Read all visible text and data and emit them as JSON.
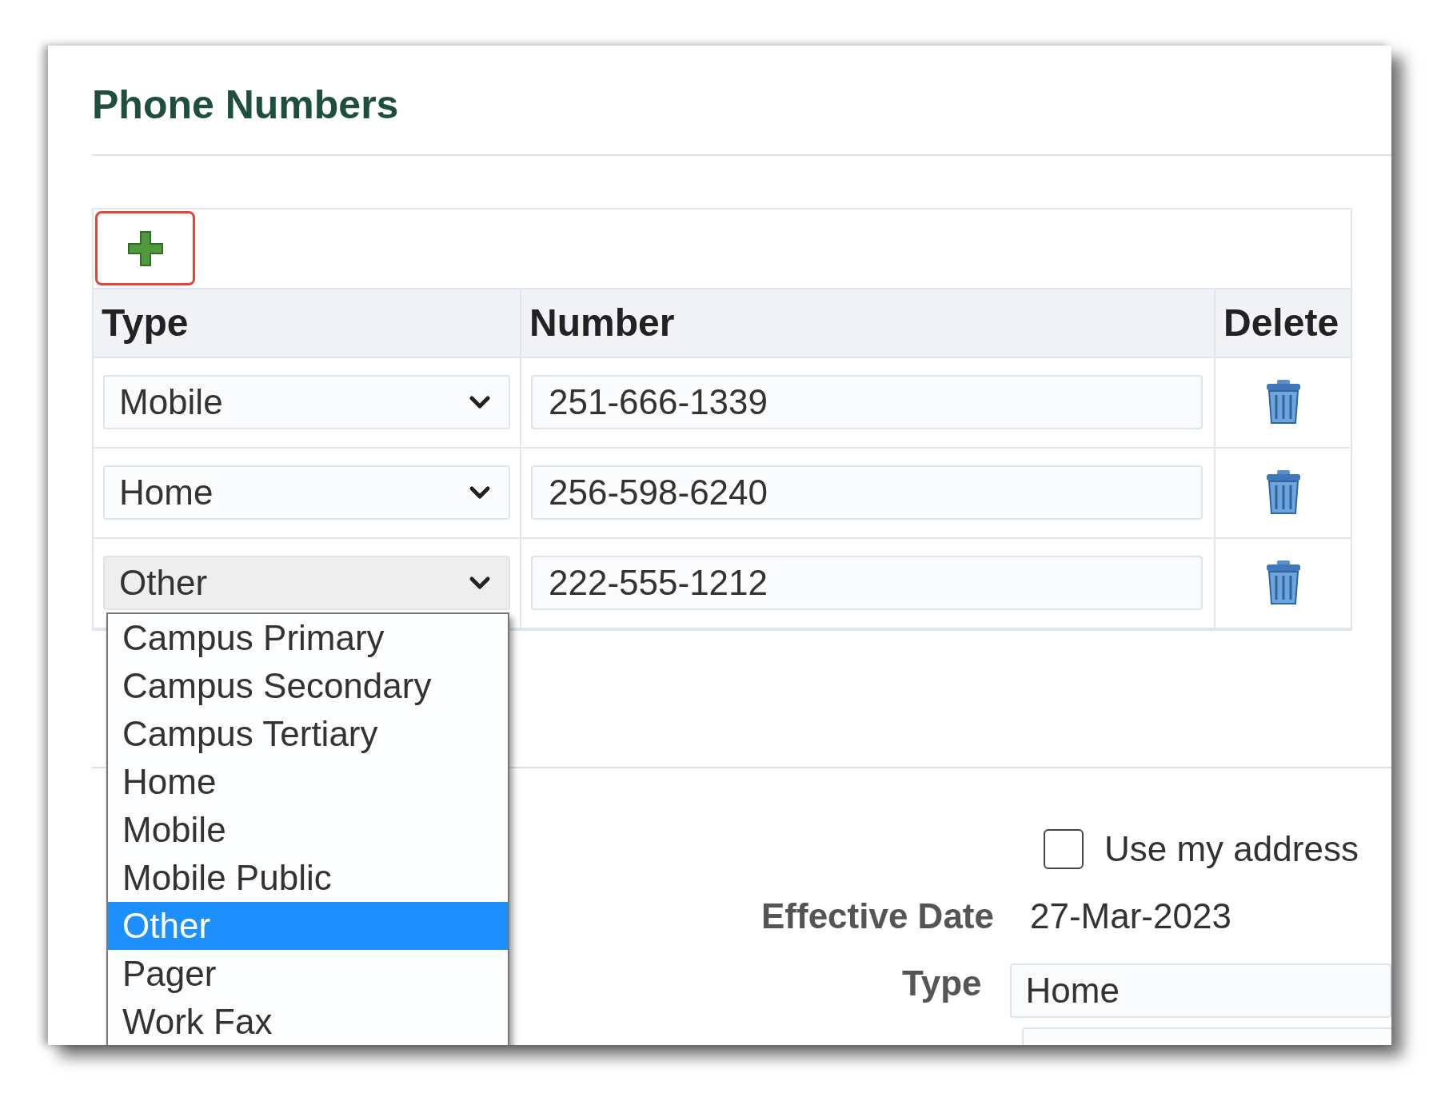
{
  "section": {
    "title": "Phone Numbers"
  },
  "table": {
    "add_button": {
      "highlighted": true
    },
    "columns": [
      "Type",
      "Number",
      "Delete"
    ],
    "rows": [
      {
        "type": "Mobile",
        "number": "251-666-1339",
        "open": false
      },
      {
        "type": "Home",
        "number": "256-598-6240",
        "open": false
      },
      {
        "type": "Other",
        "number": "222-555-1212",
        "open": true,
        "options": [
          {
            "label": "Campus Primary",
            "selected": false
          },
          {
            "label": "Campus Secondary",
            "selected": false
          },
          {
            "label": "Campus Tertiary",
            "selected": false
          },
          {
            "label": "Home",
            "selected": false
          },
          {
            "label": "Mobile",
            "selected": false
          },
          {
            "label": "Mobile Public",
            "selected": false
          },
          {
            "label": "Other",
            "selected": true
          },
          {
            "label": "Pager",
            "selected": false
          },
          {
            "label": "Work Fax",
            "selected": false
          }
        ]
      }
    ]
  },
  "address_form": {
    "checkbox": {
      "label": "Use my address",
      "checked": false
    },
    "effective_date": {
      "label": "Effective Date",
      "value": "27-Mar-2023"
    },
    "type": {
      "label": "Type",
      "value": "Home"
    }
  }
}
